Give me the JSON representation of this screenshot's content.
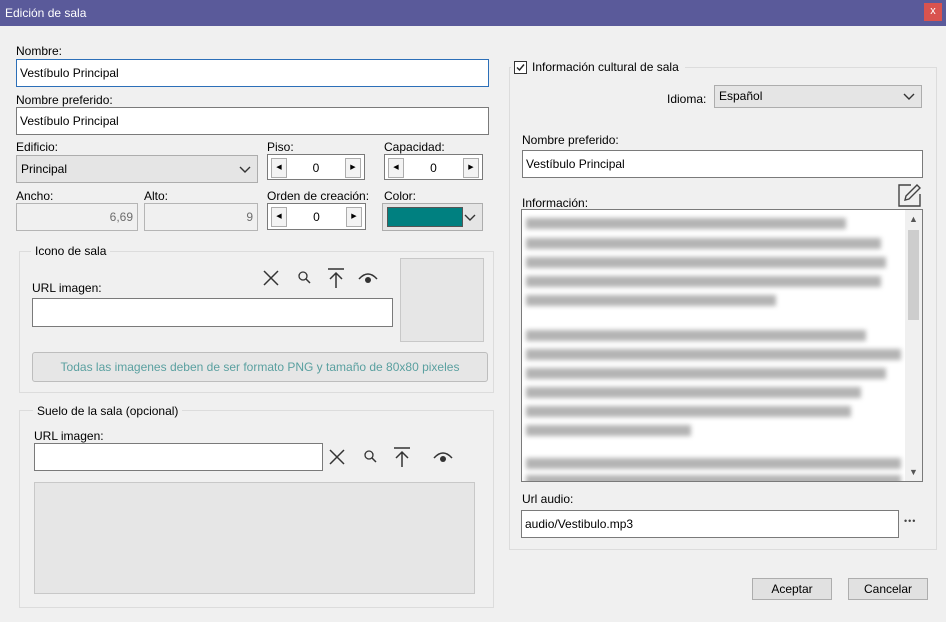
{
  "window": {
    "title": "Edición de sala",
    "close": "x"
  },
  "left": {
    "nombre": {
      "label": "Nombre:",
      "value": "Vestíbulo Principal"
    },
    "nombre_preferido": {
      "label": "Nombre preferido:",
      "value": "Vestíbulo Principal"
    },
    "edificio": {
      "label": "Edificio:",
      "value": "Principal"
    },
    "piso": {
      "label": "Piso:",
      "value": "0"
    },
    "capacidad": {
      "label": "Capacidad:",
      "value": "0"
    },
    "ancho": {
      "label": "Ancho:",
      "value": "6,69"
    },
    "alto": {
      "label": "Alto:",
      "value": "9"
    },
    "orden": {
      "label": "Orden de creación:",
      "value": "0"
    },
    "color": {
      "label": "Color:",
      "value": "#008080"
    },
    "icono": {
      "title": "Icono de sala",
      "url_label": "URL imagen:",
      "url_value": "",
      "notice": "Todas las imagenes deben de ser formato PNG y tamaño de 80x80 pixeles"
    },
    "suelo": {
      "title": "Suelo de la sala (opcional)",
      "url_label": "URL imagen:",
      "url_value": ""
    }
  },
  "right": {
    "cultural": {
      "label": "Información cultural de sala",
      "checked": true
    },
    "idioma": {
      "label": "Idioma:",
      "value": "Español"
    },
    "nombre_preferido": {
      "label": "Nombre preferido:",
      "value": "Vestíbulo Principal"
    },
    "informacion": {
      "label": "Información:"
    },
    "url_audio": {
      "label": "Url audio:",
      "value": "audio/Vestibulo.mp3"
    },
    "more": "•••"
  },
  "footer": {
    "aceptar": "Aceptar",
    "cancelar": "Cancelar"
  },
  "icons": [
    "close-x-icon",
    "search-icon",
    "upload-icon",
    "eye-icon",
    "edit-icon",
    "chevron-down-icon",
    "ellipsis-icon"
  ]
}
